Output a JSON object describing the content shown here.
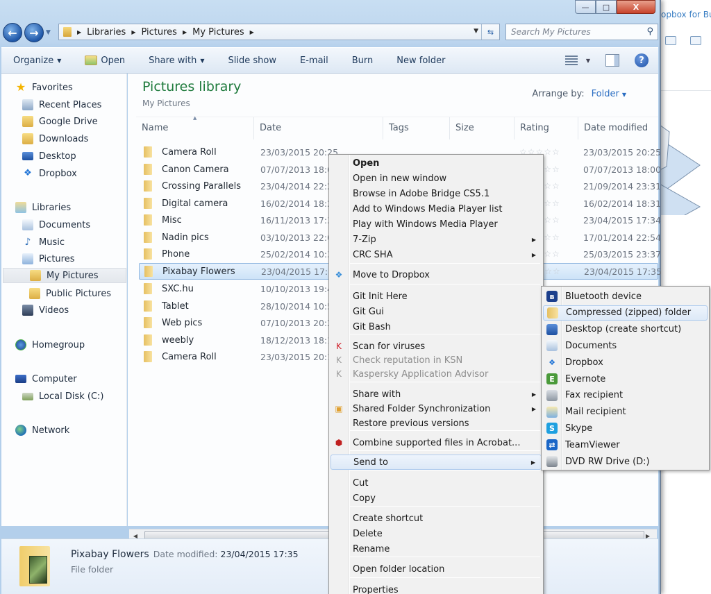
{
  "window": {
    "controls": {
      "minimize": "—",
      "maximize": "□",
      "close": "X"
    }
  },
  "background_app": {
    "title": "opbox for Bu"
  },
  "navigation": {
    "back_icon": "back-arrow-icon",
    "forward_icon": "forward-arrow-icon",
    "breadcrumb": [
      "Libraries",
      "Pictures",
      "My Pictures"
    ],
    "search_placeholder": "Search My Pictures"
  },
  "toolbar": {
    "organize": "Organize",
    "open": "Open",
    "share_with": "Share with",
    "slide_show": "Slide show",
    "email": "E-mail",
    "burn": "Burn",
    "new_folder": "New folder"
  },
  "sidebar": {
    "favorites": {
      "label": "Favorites",
      "items": [
        "Recent Places",
        "Google Drive",
        "Downloads",
        "Desktop",
        "Dropbox"
      ]
    },
    "libraries": {
      "label": "Libraries",
      "items": [
        "Documents",
        "Music",
        "Pictures",
        "My Pictures",
        "Public Pictures",
        "Videos"
      ],
      "selected": "My Pictures"
    },
    "homegroup": "Homegroup",
    "computer": {
      "label": "Computer",
      "items": [
        "Local Disk (C:)"
      ]
    },
    "network": "Network"
  },
  "content": {
    "title": "Pictures library",
    "subtitle": "My Pictures",
    "arrange_label": "Arrange by:",
    "arrange_value": "Folder",
    "columns": [
      "Name",
      "Date",
      "Tags",
      "Size",
      "Rating",
      "Date modified"
    ],
    "rows": [
      {
        "name": "Camera Roll",
        "date": "23/03/2015 20:25",
        "modified": "23/03/2015 20:25",
        "rating": "☆☆☆☆☆"
      },
      {
        "name": "Canon Camera",
        "date": "07/07/2013 18:0",
        "modified": "07/07/2013 18:00",
        "rating": "☆☆☆☆☆"
      },
      {
        "name": "Crossing Parallels",
        "date": "23/04/2014 22:2",
        "modified": "21/09/2014 23:31",
        "rating": "☆☆☆☆☆"
      },
      {
        "name": "Digital camera",
        "date": "16/02/2014 18:2",
        "modified": "16/02/2014 18:31",
        "rating": "☆☆☆☆☆"
      },
      {
        "name": "Misc",
        "date": "16/11/2013 17:3",
        "modified": "23/04/2015 17:34",
        "rating": "☆☆☆☆☆"
      },
      {
        "name": "Nadin pics",
        "date": "03/10/2013 22:0",
        "modified": "17/01/2014 22:54",
        "rating": "☆☆☆☆☆"
      },
      {
        "name": "Phone",
        "date": "25/02/2014 10:3",
        "modified": "25/03/2015 23:37",
        "rating": "☆☆☆☆☆"
      },
      {
        "name": "Pixabay Flowers",
        "date": "23/04/2015 17:3",
        "modified": "23/04/2015 17:35",
        "rating": "☆☆☆☆☆",
        "selected": true
      },
      {
        "name": "SXC.hu",
        "date": "10/10/2013 19:4",
        "modified": "",
        "rating": ""
      },
      {
        "name": "Tablet",
        "date": "28/10/2014 10:5",
        "modified": "",
        "rating": ""
      },
      {
        "name": "Web pics",
        "date": "07/10/2013 20:2",
        "modified": "",
        "rating": ""
      },
      {
        "name": "weebly",
        "date": "18/12/2013 18:1",
        "modified": "",
        "rating": ""
      },
      {
        "name": "Camera Roll",
        "date": "23/03/2015 20:1",
        "modified": "",
        "rating": ""
      }
    ]
  },
  "details_pane": {
    "name": "Pixabay Flowers",
    "modified_label": "Date modified:",
    "modified_value": "23/04/2015 17:35",
    "type": "File folder"
  },
  "context_menu": {
    "items": [
      {
        "label": "Open",
        "bold": true
      },
      {
        "label": "Open in new window"
      },
      {
        "label": "Browse in Adobe Bridge CS5.1"
      },
      {
        "label": "Add to Windows Media Player list"
      },
      {
        "label": "Play with Windows Media Player"
      },
      {
        "label": "7-Zip",
        "submenu": true
      },
      {
        "label": "CRC SHA",
        "submenu": true
      },
      {
        "label": "Move to Dropbox",
        "icon": "dropbox-icon"
      },
      {
        "label": "Git Init Here"
      },
      {
        "label": "Git Gui"
      },
      {
        "label": "Git Bash"
      },
      {
        "label": "Scan for viruses",
        "icon": "kaspersky-icon"
      },
      {
        "label": "Check reputation in KSN",
        "icon": "kaspersky-icon",
        "disabled": true
      },
      {
        "label": "Kaspersky Application Advisor",
        "icon": "kaspersky-icon",
        "disabled": true
      },
      {
        "label": "Share with",
        "submenu": true
      },
      {
        "label": "Shared Folder Synchronization",
        "icon": "sync-icon",
        "submenu": true
      },
      {
        "label": "Restore previous versions"
      },
      {
        "label": "Combine supported files in Acrobat...",
        "icon": "acrobat-icon"
      },
      {
        "label": "Send to",
        "submenu": true,
        "highlighted": true
      },
      {
        "label": "Cut"
      },
      {
        "label": "Copy"
      },
      {
        "label": "Create shortcut"
      },
      {
        "label": "Delete"
      },
      {
        "label": "Rename"
      },
      {
        "label": "Open folder location"
      },
      {
        "label": "Properties"
      }
    ]
  },
  "send_to_menu": {
    "items": [
      {
        "label": "Bluetooth device",
        "icon": "bluetooth-icon"
      },
      {
        "label": "Compressed (zipped) folder",
        "icon": "zip-folder-icon",
        "highlighted": true
      },
      {
        "label": "Desktop (create shortcut)",
        "icon": "desktop-icon"
      },
      {
        "label": "Documents",
        "icon": "documents-icon"
      },
      {
        "label": "Dropbox",
        "icon": "dropbox-icon"
      },
      {
        "label": "Evernote",
        "icon": "evernote-icon"
      },
      {
        "label": "Fax recipient",
        "icon": "fax-icon"
      },
      {
        "label": "Mail recipient",
        "icon": "mail-icon"
      },
      {
        "label": "Skype",
        "icon": "skype-icon"
      },
      {
        "label": "TeamViewer",
        "icon": "teamviewer-icon"
      },
      {
        "label": "DVD RW Drive (D:)",
        "icon": "dvd-drive-icon"
      }
    ]
  },
  "colors": {
    "library_title": "#1e7a3c",
    "link_blue": "#2a6dc2",
    "selection": "#cde3f8"
  }
}
